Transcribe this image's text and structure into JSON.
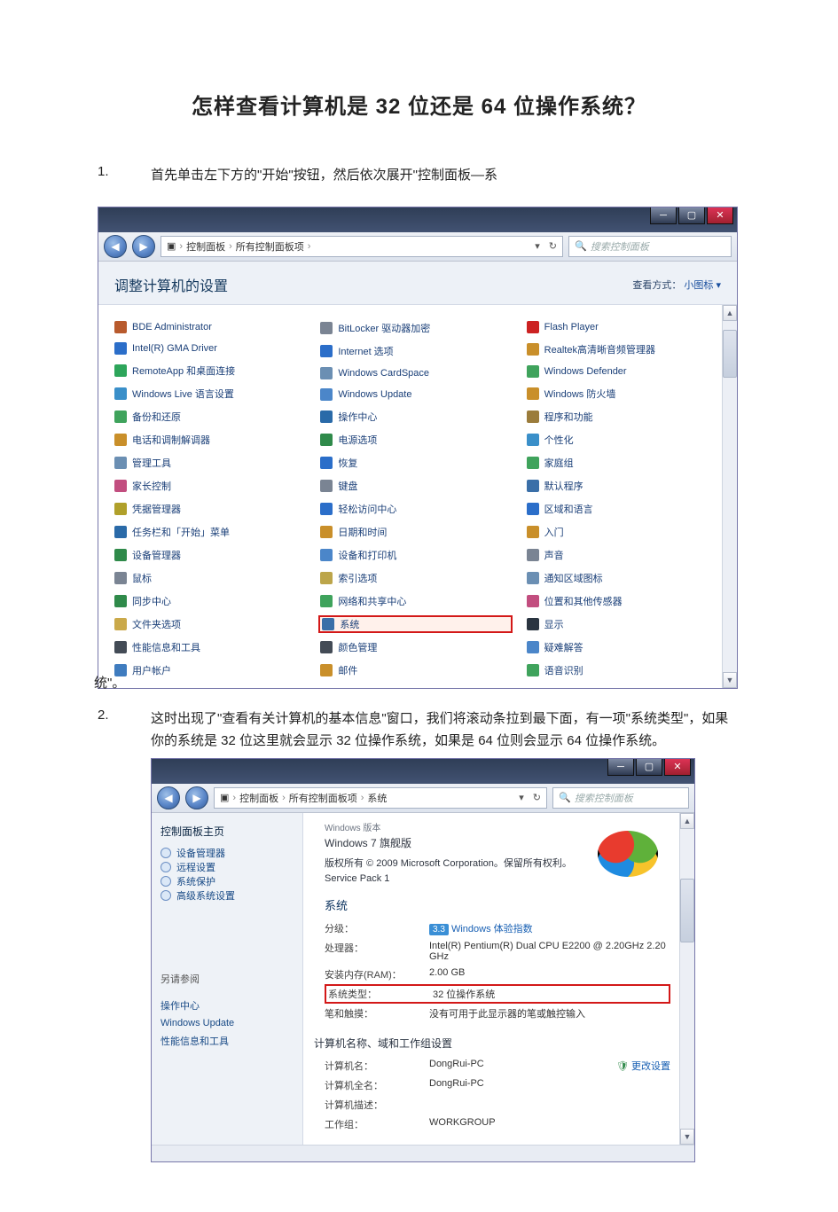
{
  "doc": {
    "title": "怎样查看计算机是 32 位还是 64 位操作系统？",
    "step1_num": "1.",
    "step1_text": "首先单击左下方的\"开始\"按钮，然后依次展开\"控制面板—系",
    "step1_cont": "统\"。",
    "step2_num": "2.",
    "step2_text": "这时出现了\"查看有关计算机的基本信息\"窗口，我们将滚动条拉到最下面，有一项\"系统类型\"，如果你的系统是 32 位这里就会显示 32 位操作系统，如果是 64 位则会显示 64 位操作系统。"
  },
  "win_common": {
    "search_placeholder": "搜索控制面板"
  },
  "cp_window": {
    "breadcrumb": [
      "▣",
      "›",
      "控制面板",
      "›",
      "所有控制面板项",
      "›"
    ],
    "head_left": "调整计算机的设置",
    "head_right_label": "查看方式：",
    "head_right_value": "小图标 ▾",
    "cols": [
      [
        {
          "t": "BDE Administrator",
          "c": "#b85a2d"
        },
        {
          "t": "Intel(R) GMA Driver",
          "c": "#2b6ec9"
        },
        {
          "t": "RemoteApp 和桌面连接",
          "c": "#2da55a"
        },
        {
          "t": "Windows Live 语言设置",
          "c": "#3a8fc9"
        },
        {
          "t": "备份和还原",
          "c": "#3fa35c"
        },
        {
          "t": "电话和调制解调器",
          "c": "#c98f2a"
        },
        {
          "t": "管理工具",
          "c": "#6b8fb3"
        },
        {
          "t": "家长控制",
          "c": "#c24e7f"
        },
        {
          "t": "凭据管理器",
          "c": "#b0a02a"
        },
        {
          "t": "任务栏和「开始」菜单",
          "c": "#2a6aa8"
        },
        {
          "t": "设备管理器",
          "c": "#2f8a4a"
        },
        {
          "t": "鼠标",
          "c": "#7a8493"
        },
        {
          "t": "同步中心",
          "c": "#2f8a4a"
        },
        {
          "t": "文件夹选项",
          "c": "#caa94a"
        },
        {
          "t": "性能信息和工具",
          "c": "#434b56"
        },
        {
          "t": "用户帐户",
          "c": "#3f7cbf"
        }
      ],
      [
        {
          "t": "BitLocker 驱动器加密",
          "c": "#7a8493"
        },
        {
          "t": "Internet 选项",
          "c": "#2b6ec9"
        },
        {
          "t": "Windows CardSpace",
          "c": "#6b8fb3"
        },
        {
          "t": "Windows Update",
          "c": "#4b86c9"
        },
        {
          "t": "操作中心",
          "c": "#2a6aa8"
        },
        {
          "t": "电源选项",
          "c": "#2f8a4a"
        },
        {
          "t": "恢复",
          "c": "#2b6ec9"
        },
        {
          "t": "键盘",
          "c": "#7a8493"
        },
        {
          "t": "轻松访问中心",
          "c": "#2b6ec9"
        },
        {
          "t": "日期和时间",
          "c": "#c98f2a"
        },
        {
          "t": "设备和打印机",
          "c": "#4b86c9"
        },
        {
          "t": "索引选项",
          "c": "#bca54a"
        },
        {
          "t": "网络和共享中心",
          "c": "#3fa35c"
        },
        {
          "t": "系统",
          "c": "#3a6fa8",
          "hl": true
        },
        {
          "t": "颜色管理",
          "c": "#434b56"
        },
        {
          "t": "邮件",
          "c": "#c98f2a"
        }
      ],
      [
        {
          "t": "Flash Player",
          "c": "#c22"
        },
        {
          "t": "Realtek高清晰音频管理器",
          "c": "#c98f2a"
        },
        {
          "t": "Windows Defender",
          "c": "#3fa35c"
        },
        {
          "t": "Windows 防火墙",
          "c": "#c98f2a"
        },
        {
          "t": "程序和功能",
          "c": "#9b7c3b"
        },
        {
          "t": "个性化",
          "c": "#3a8fc9"
        },
        {
          "t": "家庭组",
          "c": "#3fa35c"
        },
        {
          "t": "默认程序",
          "c": "#3a6fa8"
        },
        {
          "t": "区域和语言",
          "c": "#2b6ec9"
        },
        {
          "t": "入门",
          "c": "#c98f2a"
        },
        {
          "t": "声音",
          "c": "#7a8493"
        },
        {
          "t": "通知区域图标",
          "c": "#6b8fb3"
        },
        {
          "t": "位置和其他传感器",
          "c": "#c24e7f"
        },
        {
          "t": "显示",
          "c": "#2a3440"
        },
        {
          "t": "疑难解答",
          "c": "#4b86c9"
        },
        {
          "t": "语音识别",
          "c": "#3fa35c"
        }
      ]
    ]
  },
  "sys_window": {
    "breadcrumb": [
      "▣",
      "›",
      "控制面板",
      "›",
      "所有控制面板项",
      "›",
      "系统"
    ],
    "sidebar_head": "控制面板主页",
    "sidebar_links": [
      "设备管理器",
      "远程设置",
      "系统保护",
      "高级系统设置"
    ],
    "see_also_head": "另请参阅",
    "see_also": [
      "操作中心",
      "Windows Update",
      "性能信息和工具"
    ],
    "edition_sub": "Windows 版本",
    "edition": "Windows 7 旗舰版",
    "copyright": "版权所有 © 2009 Microsoft Corporation。保留所有权利。",
    "service_pack": "Service Pack 1",
    "sys_hdr": "系统",
    "rating_k": "分级：",
    "rating_badge": "3.3",
    "rating_v": "Windows 体验指数",
    "proc_k": "处理器：",
    "proc_v": "Intel(R) Pentium(R) Dual  CPU  E2200  @ 2.20GHz  2.20 GHz",
    "ram_k": "安装内存(RAM)：",
    "ram_v": "2.00 GB",
    "type_k": "系统类型：",
    "type_v": "32 位操作系统",
    "pen_k": "笔和触摸：",
    "pen_v": "没有可用于此显示器的笔或触控输入",
    "name_hdr": "计算机名称、域和工作组设置",
    "cn_k": "计算机名：",
    "cn_v": "DongRui-PC",
    "change": "更改设置",
    "cfn_k": "计算机全名：",
    "cfn_v": "DongRui-PC",
    "desc_k": "计算机描述：",
    "desc_v": "",
    "wg_k": "工作组：",
    "wg_v": "WORKGROUP"
  }
}
